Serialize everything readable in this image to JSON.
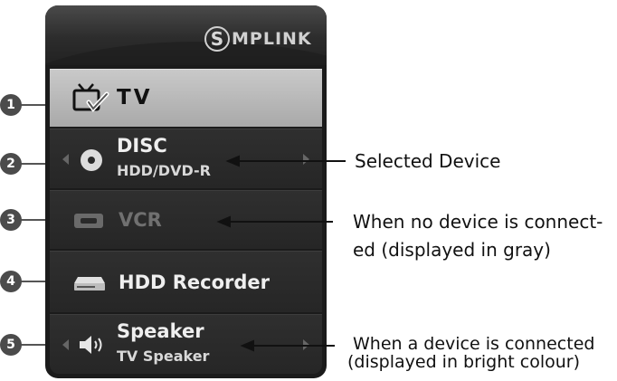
{
  "menu": {
    "logo_text": "MPLINK",
    "logo_letter": "S",
    "items": [
      {
        "number": "1",
        "label": "TV",
        "sub": "",
        "icon": "tv-icon",
        "state": "selected"
      },
      {
        "number": "2",
        "label": "DISC",
        "sub": "HDD/DVD-R",
        "icon": "disc-icon",
        "state": "connected"
      },
      {
        "number": "3",
        "label": "VCR",
        "sub": "",
        "icon": "vcr-icon",
        "state": "disconnected"
      },
      {
        "number": "4",
        "label": "HDD Recorder",
        "sub": "",
        "icon": "hdd-recorder-icon",
        "state": "connected"
      },
      {
        "number": "5",
        "label": "Speaker",
        "sub": "TV Speaker",
        "icon": "speaker-icon",
        "state": "connected"
      }
    ]
  },
  "callouts": {
    "selected_device": "Selected Device",
    "no_device_line1": "When no device is connect-",
    "no_device_line2": "ed (displayed in gray)",
    "connected_line1": "When a device is connected",
    "connected_line2": "(displayed in bright colour)"
  },
  "colors": {
    "menu_background": "#1b1b1b",
    "selected_item": "#b9b9b9",
    "disabled_text": "#707070",
    "badge": "#4b4b4b"
  }
}
